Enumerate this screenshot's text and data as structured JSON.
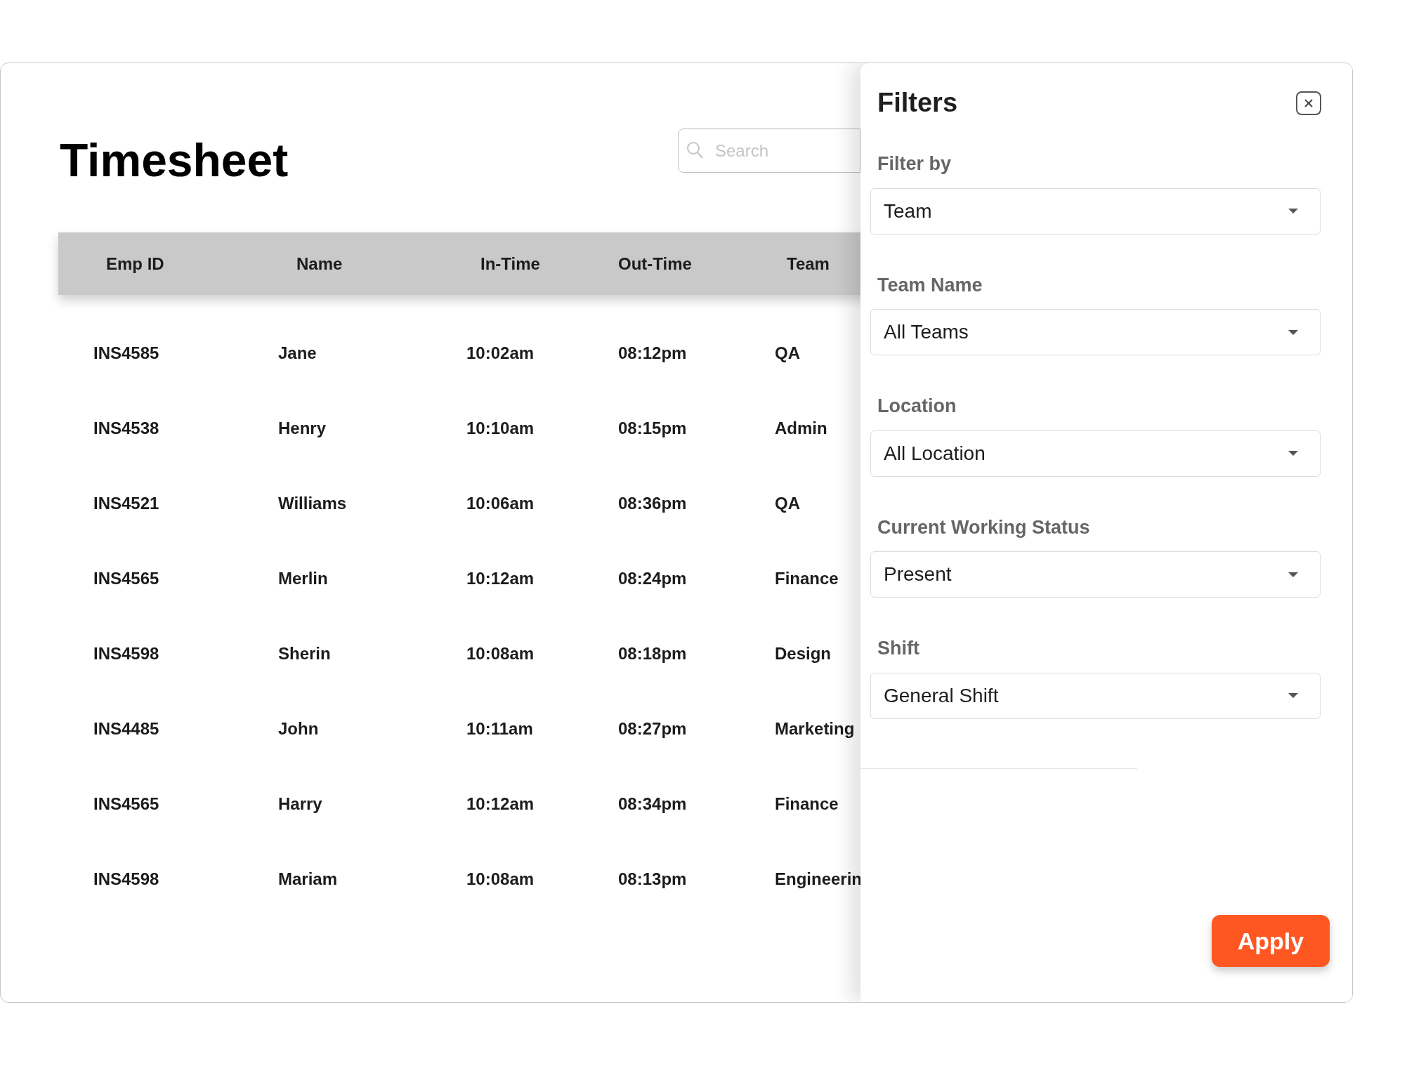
{
  "page": {
    "title": "Timesheet"
  },
  "search": {
    "placeholder": "Search"
  },
  "table": {
    "columns": [
      "Emp ID",
      "Name",
      "In-Time",
      "Out-Time",
      "Team"
    ],
    "rows": [
      [
        "INS4585",
        "Jane",
        "10:02am",
        "08:12pm",
        "QA"
      ],
      [
        "INS4538",
        "Henry",
        "10:10am",
        "08:15pm",
        "Admin"
      ],
      [
        "INS4521",
        "Williams",
        "10:06am",
        "08:36pm",
        "QA"
      ],
      [
        "INS4565",
        "Merlin",
        "10:12am",
        "08:24pm",
        "Finance"
      ],
      [
        "INS4598",
        "Sherin",
        "10:08am",
        "08:18pm",
        "Design"
      ],
      [
        "INS4485",
        "John",
        "10:11am",
        "08:27pm",
        "Marketing"
      ],
      [
        "INS4565",
        "Harry",
        "10:12am",
        "08:34pm",
        "Finance"
      ],
      [
        "INS4598",
        "Mariam",
        "10:08am",
        "08:13pm",
        "Engineerin"
      ]
    ]
  },
  "filters": {
    "title": "Filters",
    "fields": [
      {
        "label": "Filter by",
        "value": "Team"
      },
      {
        "label": "Team Name",
        "value": "All Teams"
      },
      {
        "label": "Location",
        "value": "All Location"
      },
      {
        "label": "Current Working Status",
        "value": "Present"
      },
      {
        "label": "Shift",
        "value": "General Shift"
      }
    ],
    "apply": "Apply"
  }
}
